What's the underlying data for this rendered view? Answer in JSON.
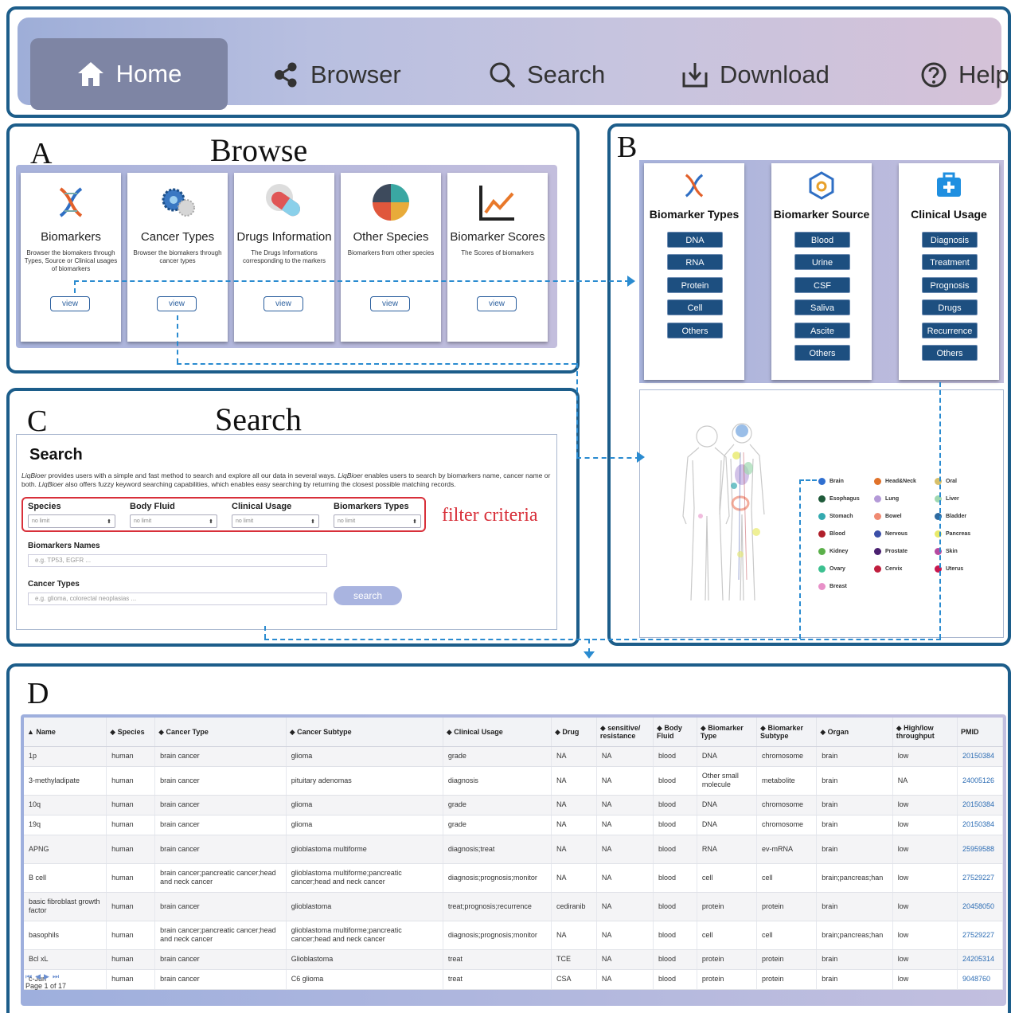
{
  "nav": {
    "items": [
      {
        "label": "Home",
        "icon": "home-icon",
        "active": true
      },
      {
        "label": "Browser",
        "icon": "share-nodes-icon"
      },
      {
        "label": "Search",
        "icon": "magnifier-icon"
      },
      {
        "label": "Download",
        "icon": "download-tray-icon"
      },
      {
        "label": "Help",
        "icon": "question-circle-icon"
      }
    ]
  },
  "panelA": {
    "letter": "A",
    "title": "Browse",
    "cards": [
      {
        "title": "Biomarkers",
        "desc": "Browser the biomakers through Types, Source or Clinical usages of biomarkers",
        "button": "view",
        "icon": "dna-icon"
      },
      {
        "title": "Cancer Types",
        "desc": "Browser the biomakers through cancer types",
        "button": "view",
        "icon": "virus-cells-icon"
      },
      {
        "title": "Drugs Information",
        "desc": "The Drugs Informations corresponding to the markers",
        "button": "view",
        "icon": "capsule-icon"
      },
      {
        "title": "Other Species",
        "desc": "Biomarkers from other species",
        "button": "view",
        "icon": "animals-icon"
      },
      {
        "title": "Biomarker Scores",
        "desc": "The Scores of biomarkers",
        "button": "view",
        "icon": "line-chart-icon"
      }
    ]
  },
  "panelB": {
    "letter": "B",
    "columns": [
      {
        "title": "Biomarker Types",
        "icon": "dna-icon",
        "items": [
          "DNA",
          "RNA",
          "Protein",
          "Cell",
          "Others"
        ]
      },
      {
        "title": "Biomarker Source",
        "icon": "hexagon-drop-icon",
        "items": [
          "Blood",
          "Urine",
          "CSF",
          "Saliva",
          "Ascite",
          "Others"
        ]
      },
      {
        "title": "Clinical Usage",
        "icon": "medical-kit-icon",
        "items": [
          "Diagnosis",
          "Treatment",
          "Prognosis",
          "Drugs",
          "Recurrence",
          "Others"
        ]
      }
    ],
    "legend": [
      {
        "label": "Brain",
        "color": "#2f6fd0"
      },
      {
        "label": "Head&Neck",
        "color": "#e0722a"
      },
      {
        "label": "Oral",
        "color": "#d7c06a"
      },
      {
        "label": "Esophagus",
        "color": "#1f5a3a"
      },
      {
        "label": "Lung",
        "color": "#b49ad8"
      },
      {
        "label": "Liver",
        "color": "#9fd8b0"
      },
      {
        "label": "Stomach",
        "color": "#34aab0"
      },
      {
        "label": "Bowel",
        "color": "#f08a72"
      },
      {
        "label": "Bladder",
        "color": "#2e6aa0"
      },
      {
        "label": "Blood",
        "color": "#b01f2a"
      },
      {
        "label": "Nervous",
        "color": "#3b4fa8"
      },
      {
        "label": "Pancreas",
        "color": "#e8ea6a"
      },
      {
        "label": "Kidney",
        "color": "#5bb04a"
      },
      {
        "label": "Prostate",
        "color": "#4a2070"
      },
      {
        "label": "Skin",
        "color": "#b64aa0"
      },
      {
        "label": "Ovary",
        "color": "#3cc090"
      },
      {
        "label": "Cervix",
        "color": "#c01e3e"
      },
      {
        "label": "Uterus",
        "color": "#c8174e"
      },
      {
        "label": "Breast",
        "color": "#e890c8"
      }
    ]
  },
  "panelC": {
    "letter": "C",
    "title": "Search",
    "heading": "Search",
    "desc": "LiqBioer provides users with a simple and fast method to search and explore all our data in several ways. LiqBioer enables users to search by biomarkers name, cancer name or both. LiqBioer also offers fuzzy keyword searching capabilities, which enables easy searching by returning the closest possible matching records.",
    "filters": [
      {
        "label": "Species",
        "value": "no limit"
      },
      {
        "label": "Body Fluid",
        "value": "no limit"
      },
      {
        "label": "Clinical Usage",
        "value": "no limit"
      },
      {
        "label": "Biomarkers Types",
        "value": "no limit"
      }
    ],
    "filter_note": "filter criteria",
    "names_label": "Biomarkers Names",
    "names_placeholder": "e.g. TP53, EGFR ...",
    "cancer_label": "Cancer Types",
    "cancer_placeholder": "e.g. glioma, colorectal neoplasias ...",
    "search_button": "search"
  },
  "panelD": {
    "letter": "D",
    "columns": [
      "▲ Name",
      "◆ Species",
      "◆ Cancer Type",
      "◆ Cancer Subtype",
      "◆ Clinical Usage",
      "◆ Drug",
      "◆ sensitive/ resistance",
      "◆ Body Fluid",
      "◆ Biomarker Type",
      "◆ Biomarker Subtype",
      "◆ Organ",
      "◆ High/low throughput",
      "PMID"
    ],
    "rows": [
      [
        "1p",
        "human",
        "brain cancer",
        "glioma",
        "grade",
        "NA",
        "NA",
        "blood",
        "DNA",
        "chromosome",
        "brain",
        "low",
        "20150384"
      ],
      [
        "3-methyladipate",
        "human",
        "brain cancer",
        "pituitary adenomas",
        "diagnosis",
        "NA",
        "NA",
        "blood",
        "Other small molecule",
        "metabolite",
        "brain",
        "NA",
        "24005126"
      ],
      [
        "10q",
        "human",
        "brain cancer",
        "glioma",
        "grade",
        "NA",
        "NA",
        "blood",
        "DNA",
        "chromosome",
        "brain",
        "low",
        "20150384"
      ],
      [
        "19q",
        "human",
        "brain cancer",
        "glioma",
        "grade",
        "NA",
        "NA",
        "blood",
        "DNA",
        "chromosome",
        "brain",
        "low",
        "20150384"
      ],
      [
        "APNG",
        "human",
        "brain cancer",
        "glioblastoma multiforme",
        "diagnosis;treat",
        "NA",
        "NA",
        "blood",
        "RNA",
        "ev-mRNA",
        "brain",
        "low",
        "25959588"
      ],
      [
        "B cell",
        "human",
        "brain cancer;pancreatic cancer;head and neck cancer",
        "glioblastoma multiforme;pancreatic cancer;head and neck cancer",
        "diagnosis;prognosis;monitor",
        "NA",
        "NA",
        "blood",
        "cell",
        "cell",
        "brain;pancreas;han",
        "low",
        "27529227"
      ],
      [
        "basic fibroblast growth factor",
        "human",
        "brain cancer",
        "glioblastoma",
        "treat;prognosis;recurrence",
        "cediranib",
        "NA",
        "blood",
        "protein",
        "protein",
        "brain",
        "low",
        "20458050"
      ],
      [
        "basophils",
        "human",
        "brain cancer;pancreatic cancer;head and neck cancer",
        "glioblastoma multiforme;pancreatic cancer;head and neck cancer",
        "diagnosis;prognosis;monitor",
        "NA",
        "NA",
        "blood",
        "cell",
        "cell",
        "brain;pancreas;han",
        "low",
        "27529227"
      ],
      [
        "Bcl xL",
        "human",
        "brain cancer",
        "Glioblastoma",
        "treat",
        "TCE",
        "NA",
        "blood",
        "protein",
        "protein",
        "brain",
        "low",
        "24205314"
      ],
      [
        "c-Jun",
        "human",
        "brain cancer",
        "C6 glioma",
        "treat",
        "CSA",
        "NA",
        "blood",
        "protein",
        "protein",
        "brain",
        "low",
        "9048760"
      ]
    ],
    "pager": "Page 1 of 17"
  }
}
